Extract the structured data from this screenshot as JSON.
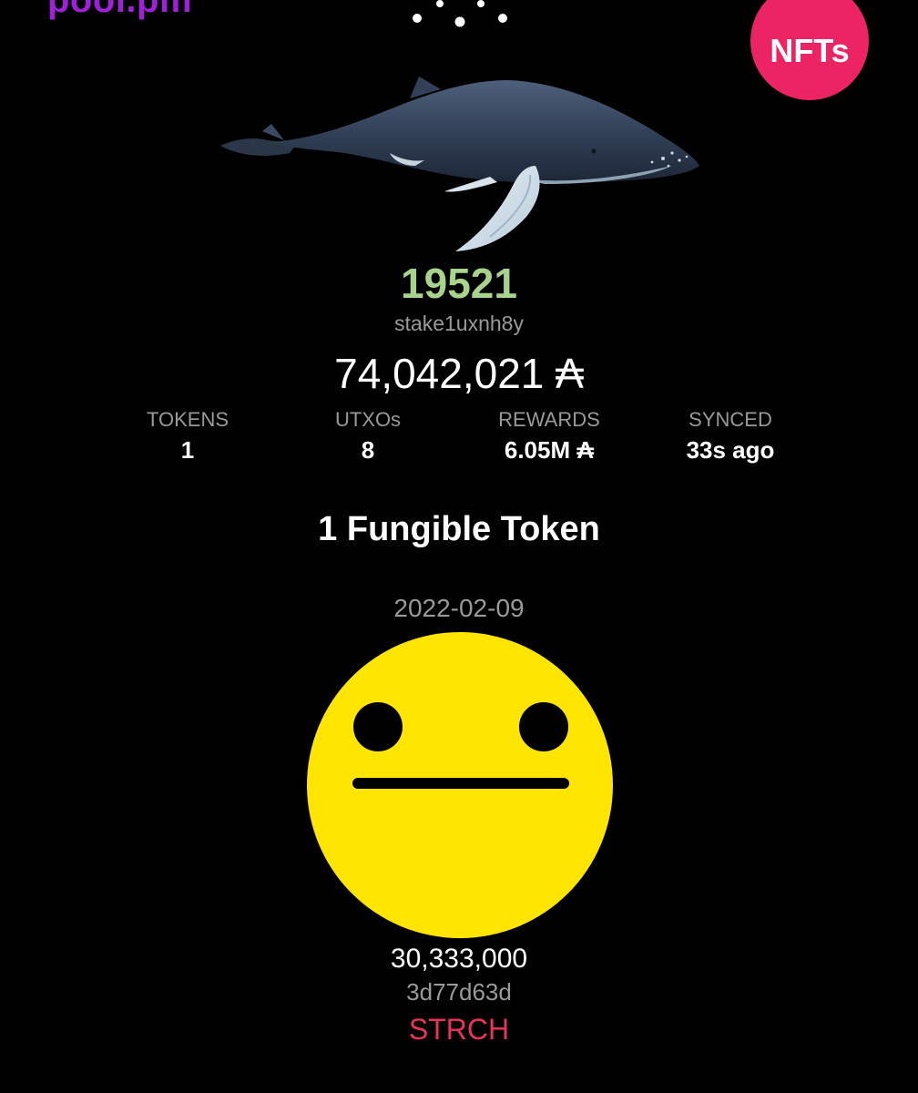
{
  "header": {
    "logo_text": "pool.pm",
    "logo_color": "#a01fd8",
    "nfts_button_label": "NFTs",
    "nfts_button_color": "#ec2463"
  },
  "wallet": {
    "rank": "19521",
    "rank_color": "#a7d48a",
    "stake_address": "stake1uxnh8y",
    "balance": "74,042,021 ₳",
    "image": "humpback-whale-icon"
  },
  "stats": [
    {
      "label": "TOKENS",
      "value": "1"
    },
    {
      "label": "UTXOs",
      "value": "8"
    },
    {
      "label": "REWARDS",
      "value": "6.05M ₳"
    },
    {
      "label": "SYNCED",
      "value": "33s ago"
    }
  ],
  "tokens_section": {
    "title": "1 Fungible Token"
  },
  "tokens": [
    {
      "date": "2022-02-09",
      "image": "neutral-face-icon",
      "image_color": "#ffe500",
      "amount": "30,333,000",
      "policy": "3d77d63d",
      "ticker": "STRCH",
      "ticker_color": "#e8345c"
    }
  ]
}
